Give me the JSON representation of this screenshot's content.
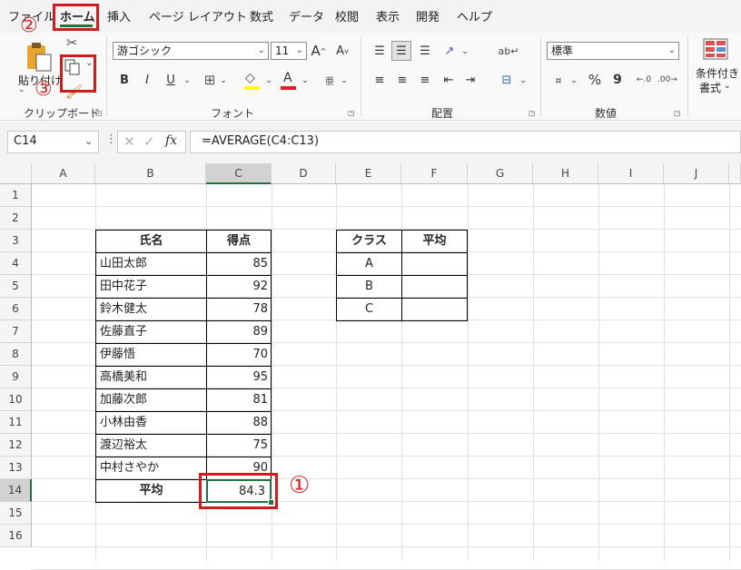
{
  "menu": {
    "tabs": [
      "ファイル",
      "ホーム",
      "挿入",
      "ページ レイアウト",
      "数式",
      "データ",
      "校閲",
      "表示",
      "開発",
      "ヘルプ"
    ],
    "active_tab": "ホーム"
  },
  "ribbon": {
    "clipboard": {
      "paste_label": "貼り付け",
      "group_label": "クリップボード"
    },
    "font": {
      "font_name": "游ゴシック",
      "font_size": "11",
      "group_label": "フォント",
      "bold": "B",
      "italic": "I",
      "underline": "U"
    },
    "alignment": {
      "group_label": "配置"
    },
    "number": {
      "format": "標準",
      "group_label": "数値",
      "percent": "%",
      "comma": "9"
    },
    "styles": {
      "conditional_label_1": "条件付き",
      "conditional_label_2": "書式"
    }
  },
  "formula_bar": {
    "name_box": "C14",
    "formula": "=AVERAGE(C4:C13)",
    "fx": "fx"
  },
  "sheet": {
    "columns": [
      "A",
      "B",
      "C",
      "D",
      "E",
      "F",
      "G",
      "H",
      "I",
      "J"
    ],
    "rows": [
      "1",
      "2",
      "3",
      "4",
      "5",
      "6",
      "7",
      "8",
      "9",
      "10",
      "11",
      "12",
      "13",
      "14",
      "15",
      "16"
    ],
    "score_table": {
      "header_name": "氏名",
      "header_score": "得点",
      "rows": [
        {
          "name": "山田太郎",
          "score": "85"
        },
        {
          "name": "田中花子",
          "score": "92"
        },
        {
          "name": "鈴木健太",
          "score": "78"
        },
        {
          "name": "佐藤直子",
          "score": "89"
        },
        {
          "name": "伊藤悟",
          "score": "70"
        },
        {
          "name": "高橋美和",
          "score": "95"
        },
        {
          "name": "加藤次郎",
          "score": "81"
        },
        {
          "name": "小林由香",
          "score": "88"
        },
        {
          "name": "渡辺裕太",
          "score": "75"
        },
        {
          "name": "中村さやか",
          "score": "90"
        }
      ],
      "average_label": "平均",
      "average_value": "84.3"
    },
    "class_table": {
      "header_class": "クラス",
      "header_avg": "平均",
      "rows": [
        "A",
        "B",
        "C"
      ]
    }
  },
  "annotations": {
    "step1": "①",
    "step2": "②",
    "step3": "③"
  },
  "colors": {
    "accent_green": "#217346",
    "annotation_red": "#d01c1c"
  }
}
